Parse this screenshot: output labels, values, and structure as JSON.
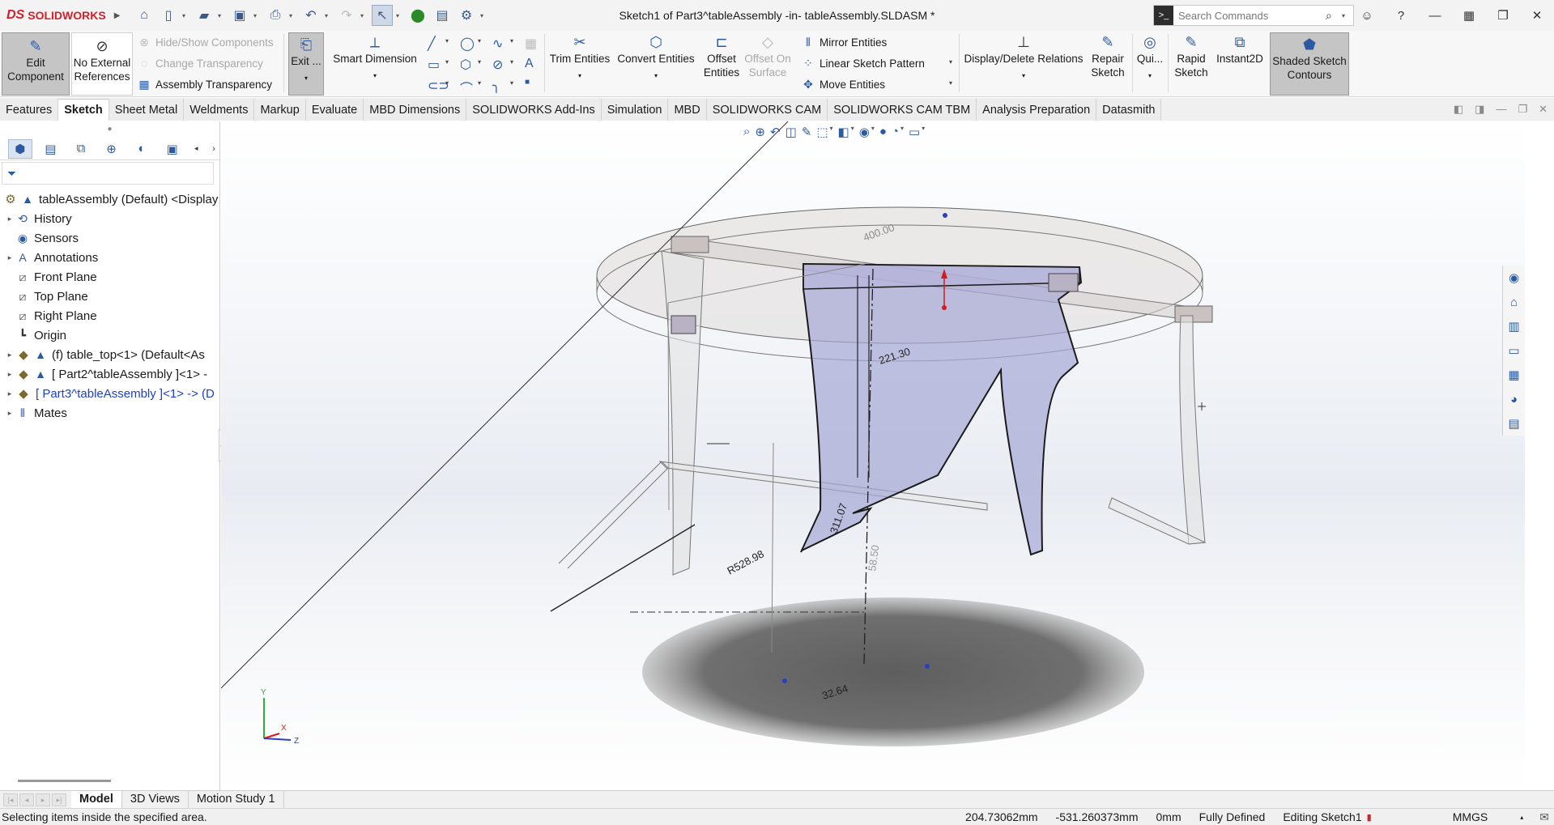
{
  "app": {
    "brand": "SOLIDWORKS",
    "doc_title": "Sketch1 of Part3^tableAssembly -in- tableAssembly.SLDASM *",
    "search_placeholder": "Search Commands"
  },
  "commands": {
    "edit_component": "Edit Component",
    "no_external_refs": "No External References",
    "hide_show_components": "Hide/Show Components",
    "change_transparency": "Change Transparency",
    "assembly_transparency": "Assembly Transparency",
    "exit": "Exit ...",
    "smart_dimension": "Smart Dimension",
    "trim_entities": "Trim Entities",
    "convert_entities": "Convert Entities",
    "offset_entities": "Offset Entities",
    "offset_on_surface": "Offset On Surface",
    "mirror_entities": "Mirror Entities",
    "linear_sketch_pattern": "Linear Sketch Pattern",
    "move_entities": "Move Entities",
    "display_delete_relations": "Display/Delete Relations",
    "repair_sketch": "Repair Sketch",
    "quick_snaps": "Qui...",
    "rapid_sketch": "Rapid Sketch",
    "instant2d": "Instant2D",
    "shaded_sketch_contours": "Shaded Sketch Contours"
  },
  "tabs": [
    "Features",
    "Sketch",
    "Sheet Metal",
    "Weldments",
    "Markup",
    "Evaluate",
    "MBD Dimensions",
    "SOLIDWORKS Add-Ins",
    "Simulation",
    "MBD",
    "SOLIDWORKS CAM",
    "SOLIDWORKS CAM TBM",
    "Analysis Preparation",
    "Datasmith"
  ],
  "tree": {
    "root": "tableAssembly (Default) <Display",
    "items": [
      "History",
      "Sensors",
      "Annotations",
      "Front Plane",
      "Top Plane",
      "Right Plane",
      "Origin",
      "(f) table_top<1> (Default<As",
      "[ Part2^tableAssembly ]<1> -",
      "[ Part3^tableAssembly ]<1> -> (D",
      "Mates"
    ]
  },
  "dimensions": {
    "d400": "400.00",
    "d221": "221.30",
    "d311": "311.07",
    "d528": "R528.98",
    "d58": "58.50",
    "d32": "32.64"
  },
  "triad": {
    "y": "Y",
    "x": "X",
    "z": "Z"
  },
  "bottom_tabs": [
    "Model",
    "3D Views",
    "Motion Study 1"
  ],
  "status": {
    "message": "Selecting items inside the specified area.",
    "x_coord": "204.73062mm",
    "y_coord": "-531.260373mm",
    "z_coord": "0mm",
    "defined": "Fully Defined",
    "mode": "Editing Sketch1",
    "units": "MMGS"
  },
  "colors": {
    "brand_red": "#d4202a",
    "accent_blue": "#2c5aa0",
    "sketch_fill": "#a7a8d6",
    "tree_selected": "#1c3fd3"
  }
}
